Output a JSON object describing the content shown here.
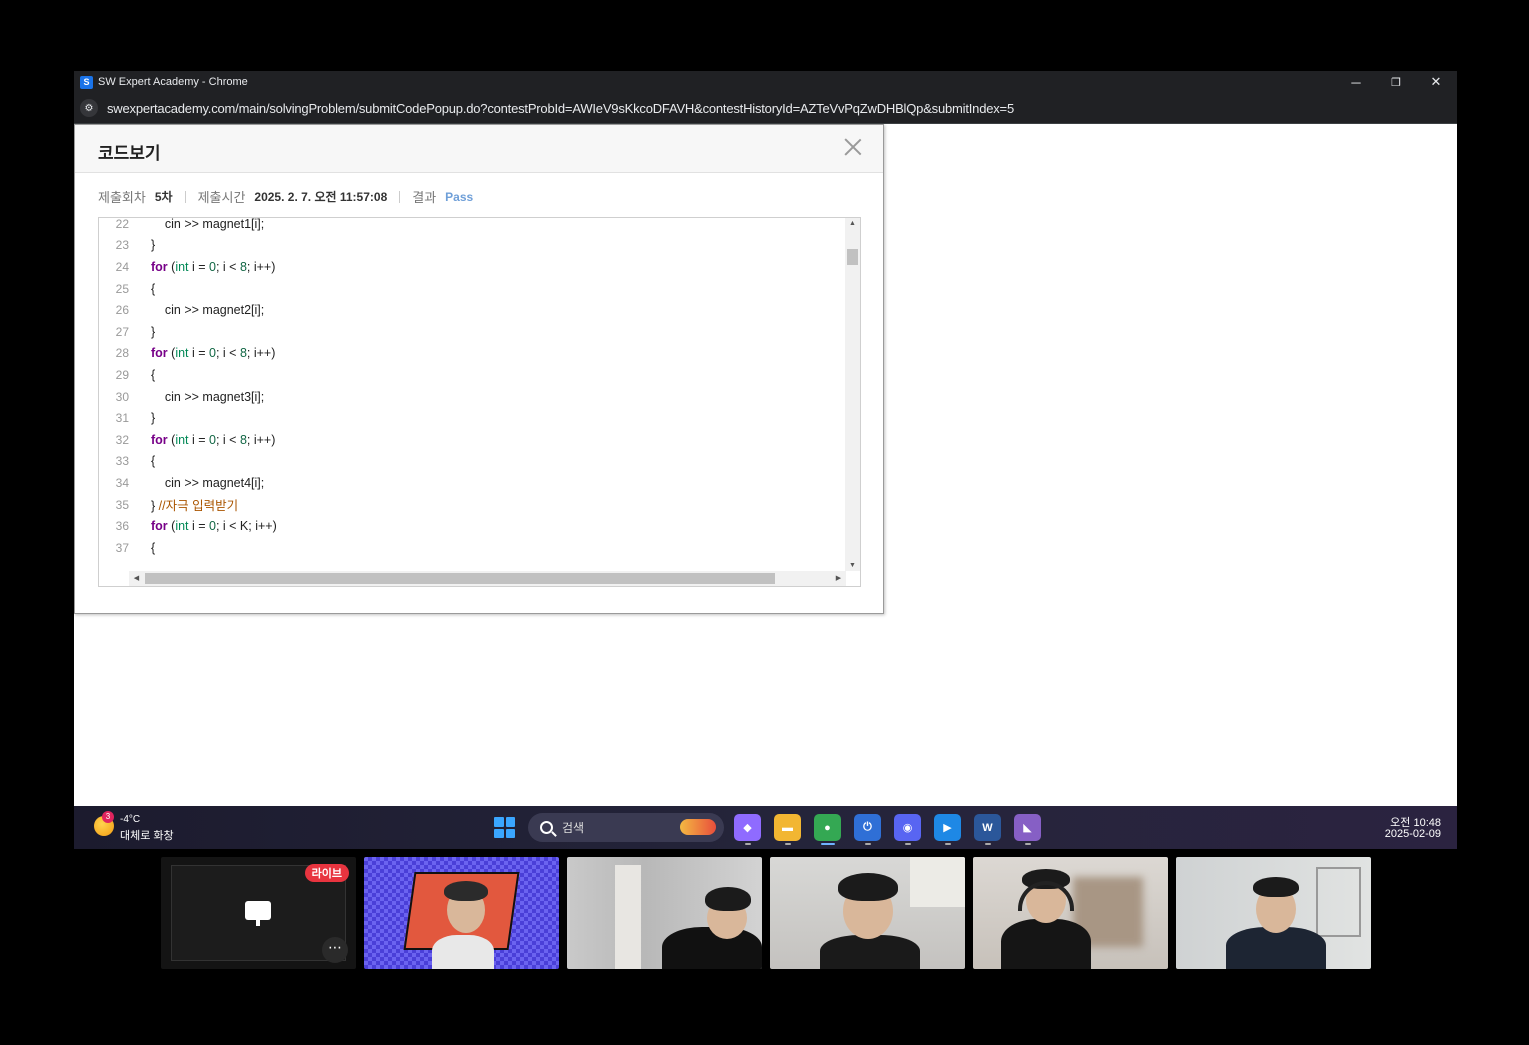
{
  "window": {
    "title": "SW Expert Academy - Chrome",
    "url": "swexpertacademy.com/main/solvingProblem/submitCodePopup.do?contestProbId=AWIeV9sKkcoDFAVH&contestHistoryId=AZTeVvPqZwDHBlQp&submitIndex=5",
    "app_icon_letter": "S",
    "controls": {
      "minimize": "─",
      "restore": "❐",
      "close": "✕"
    }
  },
  "popup": {
    "title": "코드보기",
    "meta": {
      "submit_count_label": "제출회차",
      "submit_count_value": "5차",
      "submit_time_label": "제출시간",
      "submit_time_value": "2025. 2. 7. 오전 11:57:08",
      "result_label": "결과",
      "result_value": "Pass"
    },
    "code_lines": [
      {
        "n": "22",
        "t": "        cin >> magnet1[i];"
      },
      {
        "n": "23",
        "t": "    }"
      },
      {
        "n": "24",
        "t": "    for (int i = 0; i < 8; i++)"
      },
      {
        "n": "25",
        "t": "    {"
      },
      {
        "n": "26",
        "t": "        cin >> magnet2[i];"
      },
      {
        "n": "27",
        "t": "    }"
      },
      {
        "n": "28",
        "t": "    for (int i = 0; i < 8; i++)"
      },
      {
        "n": "29",
        "t": "    {"
      },
      {
        "n": "30",
        "t": "        cin >> magnet3[i];"
      },
      {
        "n": "31",
        "t": "    }"
      },
      {
        "n": "32",
        "t": "    for (int i = 0; i < 8; i++)"
      },
      {
        "n": "33",
        "t": "    {"
      },
      {
        "n": "34",
        "t": "        cin >> magnet4[i];"
      },
      {
        "n": "35",
        "t": "    } //자극 입력받기"
      },
      {
        "n": "36",
        "t": "    for (int i = 0; i < K; i++)"
      },
      {
        "n": "37",
        "t": "    {"
      }
    ]
  },
  "taskbar": {
    "weather": {
      "badge": "3",
      "temp": "-4°C",
      "desc": "대체로 화창"
    },
    "search_label": "검색",
    "apps": [
      {
        "name": "copilot",
        "color": "#8f6bff",
        "glyph": "◆"
      },
      {
        "name": "file-explorer",
        "color": "#f2b632",
        "glyph": "▬"
      },
      {
        "name": "chrome",
        "color": "#34a853",
        "glyph": "●"
      },
      {
        "name": "power-automate",
        "color": "#2f6fd6",
        "glyph": "⏻"
      },
      {
        "name": "discord",
        "color": "#5865f2",
        "glyph": "◉"
      },
      {
        "name": "zoom",
        "color": "#1e88e5",
        "glyph": "▶"
      },
      {
        "name": "word",
        "color": "#2b579a",
        "glyph": "W"
      },
      {
        "name": "visual-studio",
        "color": "#865fc5",
        "glyph": "◣"
      }
    ],
    "clock": {
      "time": "오전 10:48",
      "date": "2025-02-09"
    }
  },
  "video_tiles": {
    "live_badge": "라이브",
    "more": "⋯"
  }
}
